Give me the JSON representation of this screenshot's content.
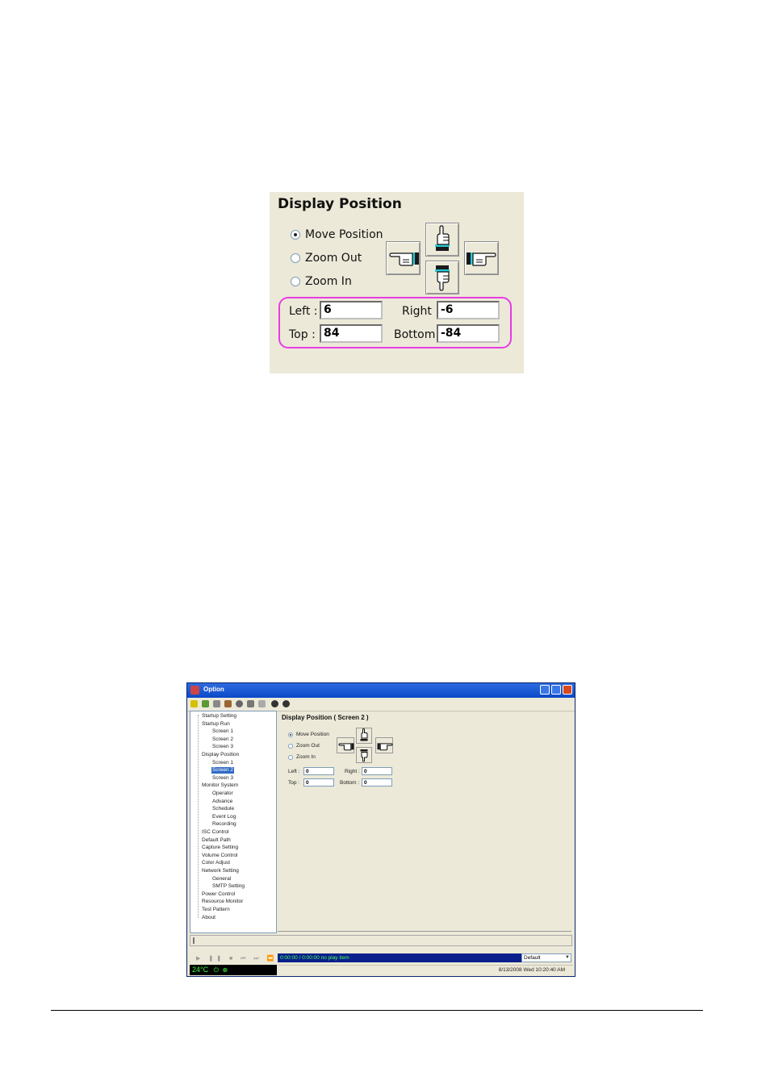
{
  "zoom": {
    "title": "Display Position",
    "modes": [
      {
        "label": "Move Position",
        "checked": true
      },
      {
        "label": "Zoom Out",
        "checked": false
      },
      {
        "label": "Zoom In",
        "checked": false
      }
    ],
    "fields": {
      "left_label": "Left :",
      "left_value": "6",
      "right_label": "Right :",
      "right_value": "-6",
      "top_label": "Top :",
      "top_value": "84",
      "bottom_label": "Bottom :",
      "bottom_value": "-84"
    },
    "highlight_color": "#e83be3"
  },
  "window": {
    "title": "Option",
    "tree": [
      {
        "label": "Startup Setting",
        "level": 1
      },
      {
        "label": "Startup Run",
        "level": 1
      },
      {
        "label": "Screen 1",
        "level": 2
      },
      {
        "label": "Screen 2",
        "level": 2
      },
      {
        "label": "Screen 3",
        "level": 2
      },
      {
        "label": "Display Position",
        "level": 1
      },
      {
        "label": "Screen 1",
        "level": 2
      },
      {
        "label": "Screen 2",
        "level": 2,
        "selected": true
      },
      {
        "label": "Screen 3",
        "level": 2
      },
      {
        "label": "Monitor System",
        "level": 1
      },
      {
        "label": "Operator",
        "level": 2
      },
      {
        "label": "Advance",
        "level": 2
      },
      {
        "label": "Schedule",
        "level": 2
      },
      {
        "label": "Event Log",
        "level": 2
      },
      {
        "label": "Recording",
        "level": 2
      },
      {
        "label": "ISC Control",
        "level": 1
      },
      {
        "label": "Default Path",
        "level": 1
      },
      {
        "label": "Capture Setting",
        "level": 1
      },
      {
        "label": "Volume Control",
        "level": 1
      },
      {
        "label": "Color Adjust",
        "level": 1
      },
      {
        "label": "Network Setting",
        "level": 1
      },
      {
        "label": "General",
        "level": 2
      },
      {
        "label": "SMTP Setting",
        "level": 2
      },
      {
        "label": "Power Control",
        "level": 1
      },
      {
        "label": "Resource Monitor",
        "level": 1
      },
      {
        "label": "Test Pattern",
        "level": 1
      },
      {
        "label": "About",
        "level": 1
      }
    ],
    "content_title": "Display Position ( Screen 2 )",
    "modes": [
      {
        "label": "Move Position",
        "checked": true
      },
      {
        "label": "Zoom Out",
        "checked": false
      },
      {
        "label": "Zoom In",
        "checked": false
      }
    ],
    "fields": {
      "left_label": "Left :",
      "left_value": "0",
      "right_label": "Right :",
      "right_value": "0",
      "top_label": "Top :",
      "top_value": "0",
      "bottom_label": "Bottom :",
      "bottom_value": "0"
    },
    "player_status": "0:00:00 / 0:00:00  no play item",
    "preset_value": "Default",
    "temperature": "24°C",
    "datetime": "8/13/2008 Wed 10:20:40 AM",
    "colors": {
      "titlebar": "#0a49c8",
      "status_bg": "#0a1f8c",
      "status_text": "#4cff4c"
    }
  }
}
